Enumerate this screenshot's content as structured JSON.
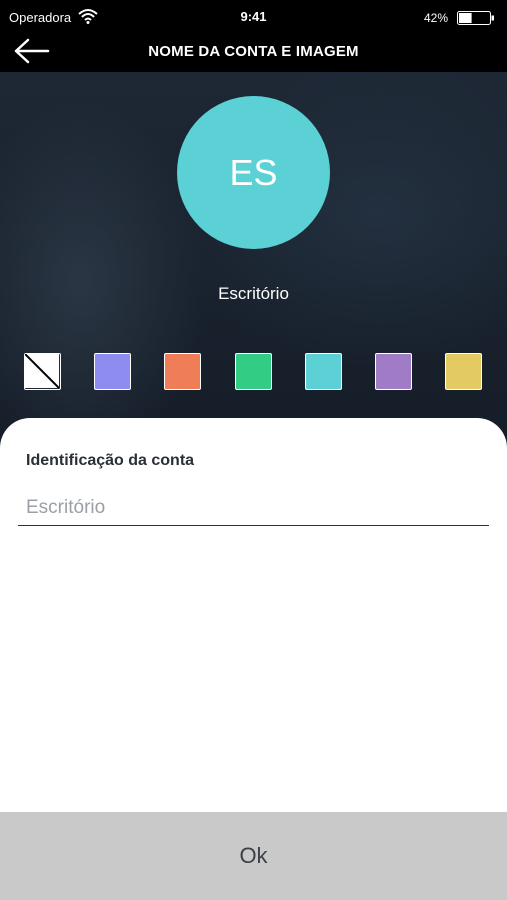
{
  "status_bar": {
    "carrier": "Operadora",
    "time": "9:41",
    "battery": "42%",
    "battery_level": 0.42
  },
  "header": {
    "title": "NOME DA CONTA E IMAGEM",
    "back_icon": "arrow-left-icon"
  },
  "avatar": {
    "initials": "ES",
    "color": "#5bd1d6"
  },
  "account": {
    "name": "Escritório"
  },
  "swatches": [
    {
      "name": "swatch-none",
      "color": "#ffffff",
      "icon": "no-color-icon"
    },
    {
      "name": "swatch-periwinkle",
      "color": "#8f8cf0"
    },
    {
      "name": "swatch-orange",
      "color": "#ef7d58"
    },
    {
      "name": "swatch-green",
      "color": "#33cc85"
    },
    {
      "name": "swatch-cyan",
      "color": "#5bd1d6"
    },
    {
      "name": "swatch-purple",
      "color": "#a17cc6"
    },
    {
      "name": "swatch-yellow",
      "color": "#e3ca63"
    }
  ],
  "form": {
    "label": "Identificação da conta",
    "placeholder": "Escritório",
    "value": ""
  },
  "ok_button": {
    "label": "Ok"
  }
}
